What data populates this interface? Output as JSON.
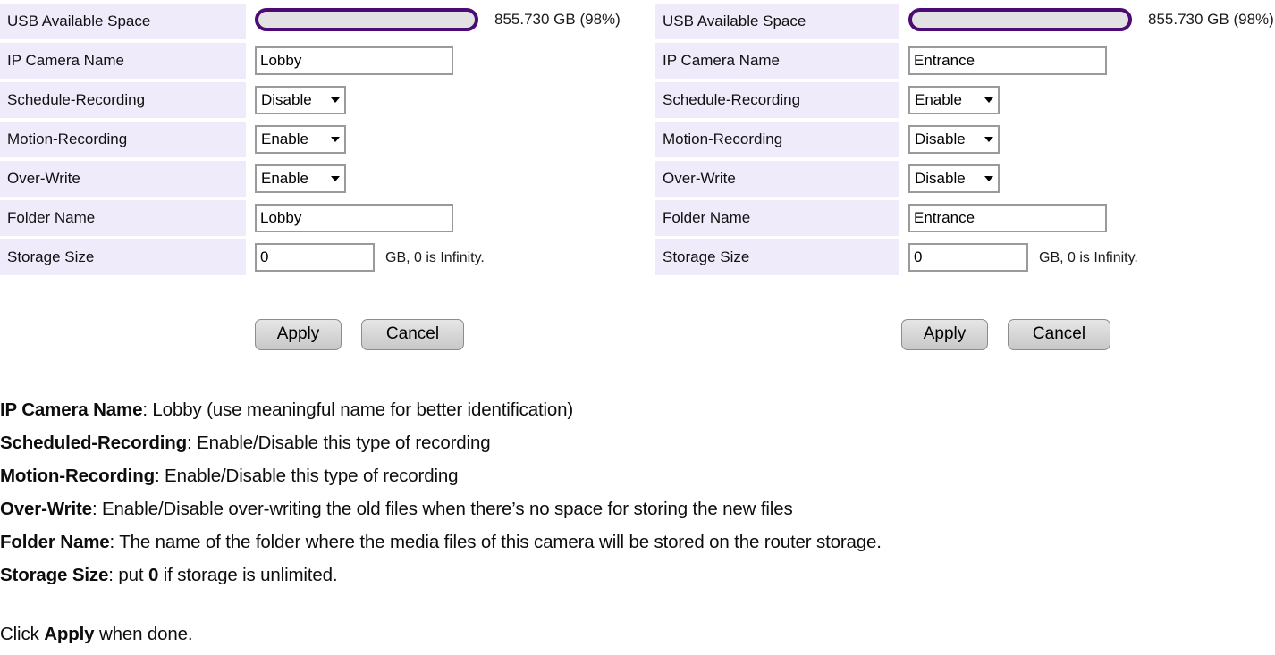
{
  "panels": [
    {
      "id": "left",
      "rows": [
        {
          "label": "USB Available Space",
          "type": "meter",
          "meter_text": "855.730 GB (98%)",
          "percent": 98
        },
        {
          "label": "IP Camera Name",
          "type": "text",
          "value": "Lobby"
        },
        {
          "label": "Schedule-Recording",
          "type": "select",
          "value": "Disable",
          "options": [
            "Enable",
            "Disable"
          ]
        },
        {
          "label": "Motion-Recording",
          "type": "select",
          "value": "Enable",
          "options": [
            "Enable",
            "Disable"
          ]
        },
        {
          "label": "Over-Write",
          "type": "select",
          "value": "Enable",
          "options": [
            "Enable",
            "Disable"
          ]
        },
        {
          "label": "Folder Name",
          "type": "text",
          "value": "Lobby"
        },
        {
          "label": "Storage Size",
          "type": "text-suffix",
          "value": "0",
          "suffix": "GB, 0 is Infinity."
        }
      ],
      "buttons": {
        "apply": "Apply",
        "cancel": "Cancel"
      }
    },
    {
      "id": "right",
      "rows": [
        {
          "label": "USB Available Space",
          "type": "meter",
          "meter_text": "855.730 GB (98%)",
          "percent": 98
        },
        {
          "label": "IP Camera Name",
          "type": "text",
          "value": "Entrance"
        },
        {
          "label": "Schedule-Recording",
          "type": "select",
          "value": "Enable",
          "options": [
            "Enable",
            "Disable"
          ]
        },
        {
          "label": "Motion-Recording",
          "type": "select",
          "value": "Disable",
          "options": [
            "Enable",
            "Disable"
          ]
        },
        {
          "label": "Over-Write",
          "type": "select",
          "value": "Disable",
          "options": [
            "Enable",
            "Disable"
          ]
        },
        {
          "label": "Folder Name",
          "type": "text",
          "value": "Entrance"
        },
        {
          "label": "Storage Size",
          "type": "text-suffix",
          "value": "0",
          "suffix": "GB, 0 is Infinity."
        }
      ],
      "buttons": {
        "apply": "Apply",
        "cancel": "Cancel"
      }
    }
  ],
  "description": {
    "lines": [
      {
        "term": "IP Camera Name",
        "rest": ": Lobby (use meaningful name for better identification)"
      },
      {
        "term": "Scheduled-Recording",
        "rest": ": Enable/Disable this type of recording"
      },
      {
        "term": "Motion-Recording",
        "rest": ": Enable/Disable this type of recording"
      },
      {
        "term": "Over-Write",
        "rest": ": Enable/Disable over-writing the old files when there’s no space for storing the new files"
      },
      {
        "term": "Folder Name",
        "rest": ": The name of the folder where the media files of this camera will be stored on the router storage."
      },
      {
        "term": "Storage Size",
        "rest": ": put ",
        "bold_mid": "0",
        "rest2": " if storage is unlimited."
      }
    ],
    "closing": {
      "pre": "Click ",
      "term": "Apply",
      "post": " when done."
    }
  },
  "colors": {
    "label_background": "#efebfb",
    "meter_border": "#4d0b75",
    "meter_fill": "#e2e2e2",
    "input_border": "#9a9a9a",
    "button_face": "#d5d5d5"
  }
}
